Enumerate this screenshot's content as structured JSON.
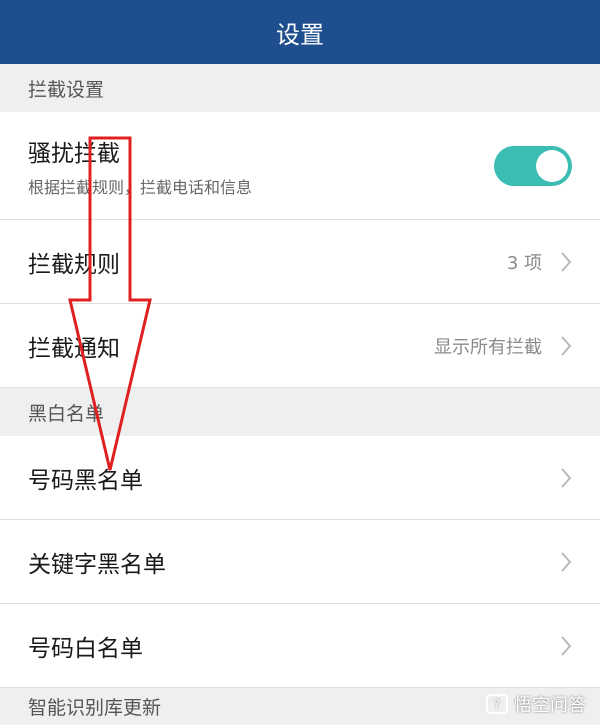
{
  "header": {
    "title": "设置"
  },
  "sections": [
    {
      "label": "拦截设置"
    },
    {
      "label": "黑白名单"
    },
    {
      "label": "智能识别库更新"
    }
  ],
  "rows": {
    "harassment": {
      "title": "骚扰拦截",
      "subtitle": "根据拦截规则，拦截电话和信息",
      "toggle_on": true
    },
    "rules": {
      "title": "拦截规则",
      "value": "3 项"
    },
    "notify": {
      "title": "拦截通知",
      "value": "显示所有拦截"
    },
    "number_blacklist": {
      "title": "号码黑名单"
    },
    "keyword_blacklist": {
      "title": "关键字黑名单"
    },
    "number_whitelist": {
      "title": "号码白名单"
    }
  },
  "watermark": {
    "text": "悟空问答"
  },
  "colors": {
    "topbar": "#1f4e8e",
    "toggle": "#3bbdb3",
    "arrow": "#e02020"
  },
  "icons": [
    "chevron-right-icon",
    "toggle-switch",
    "down-arrow-annotation",
    "wukong-logo-icon"
  ]
}
